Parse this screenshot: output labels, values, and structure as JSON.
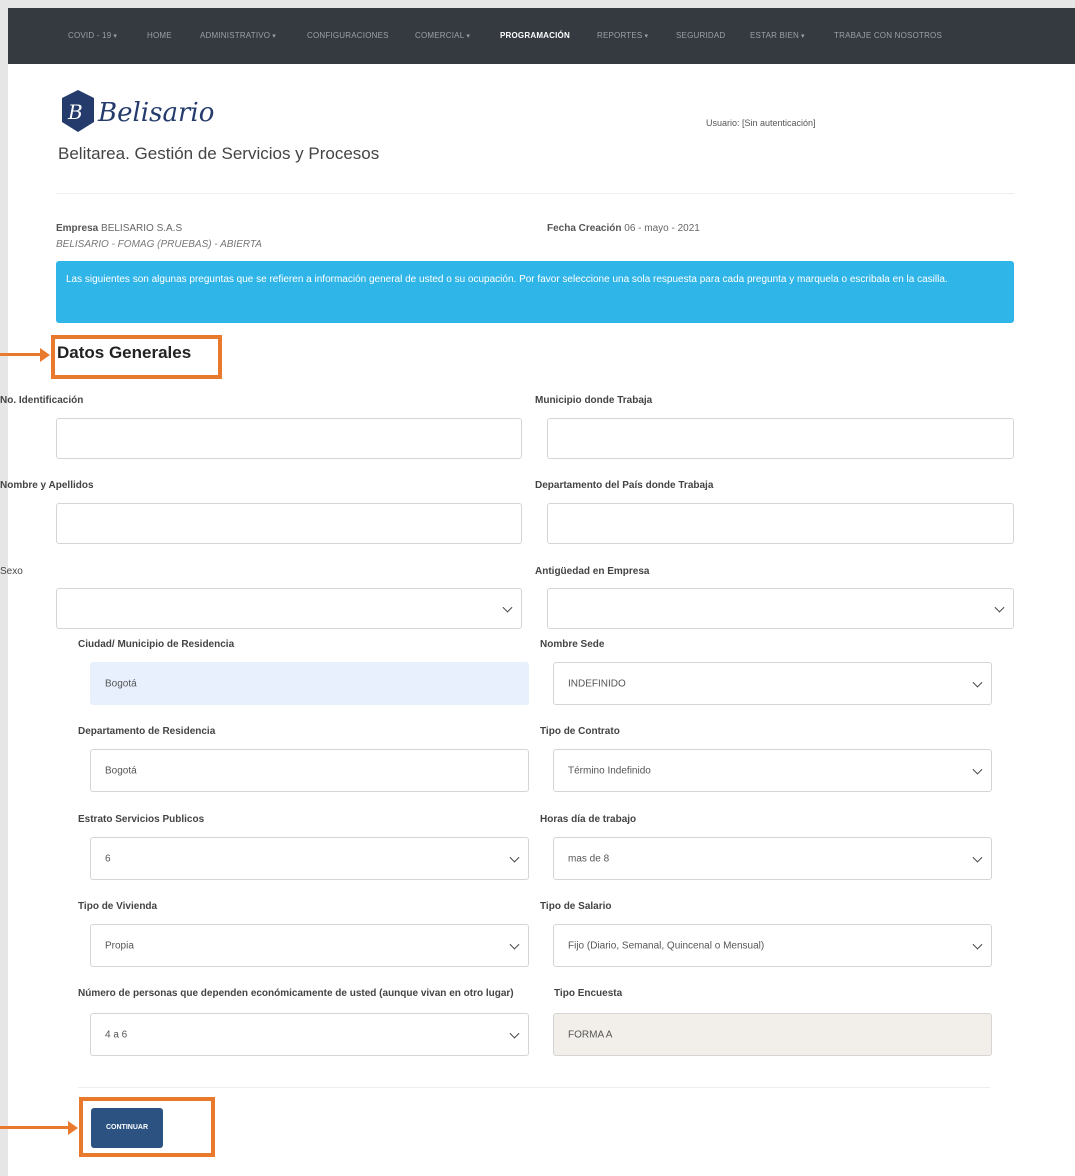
{
  "nav": {
    "items": [
      {
        "label": "COVID - 19",
        "dropdown": true
      },
      {
        "label": "HOME",
        "dropdown": false
      },
      {
        "label": "ADMINISTRATIVO",
        "dropdown": true
      },
      {
        "label": "CONFIGURACIONES",
        "dropdown": false
      },
      {
        "label": "COMERCIAL",
        "dropdown": true
      },
      {
        "label": "PROGRAMACIÓN",
        "dropdown": false,
        "active": true
      },
      {
        "label": "REPORTES",
        "dropdown": true
      },
      {
        "label": "SEGURIDAD",
        "dropdown": false
      },
      {
        "label": "ESTAR BIEN",
        "dropdown": true
      },
      {
        "label": "TRABAJE CON NOSOTROS",
        "dropdown": false
      }
    ]
  },
  "header": {
    "logo_text": "Belisario",
    "subtitle": "Belitarea. Gestión de Servicios y Procesos",
    "usuario": "Usuario: [Sin autenticación]"
  },
  "info": {
    "empresa_label": "Empresa",
    "empresa_value": "BELISARIO S.A.S",
    "empresa_sub": "BELISARIO - FOMAG (PRUEBAS) - ABIERTA",
    "fecha_label": "Fecha Creación",
    "fecha_value": "06 - mayo - 2021"
  },
  "alert": "Las siguientes son algunas preguntas que se refieren a información general de usted o su ocupación. Por favor seleccione una sola respuesta para cada pregunta y marquela o escribala en la casilla.",
  "section_title": "Datos Generales",
  "fields": {
    "no_identificacion": {
      "label": "No. Identificación",
      "value": ""
    },
    "municipio_trabaja": {
      "label": "Municipio donde Trabaja",
      "value": ""
    },
    "nombre": {
      "label": "Nombre y Apellidos",
      "value": ""
    },
    "departamento_trabaja": {
      "label": "Departamento del País donde Trabaja",
      "value": ""
    },
    "sexo": {
      "label": "Sexo",
      "value": ""
    },
    "antiguedad": {
      "label": "Antigüedad en Empresa",
      "value": ""
    },
    "ciudad_residencia": {
      "label": "Ciudad/ Municipio de Residencia",
      "value": "Bogotá"
    },
    "nombre_sede": {
      "label": "Nombre Sede",
      "value": "INDEFINIDO"
    },
    "departamento_residencia": {
      "label": "Departamento de Residencia",
      "value": "Bogotá"
    },
    "tipo_contrato": {
      "label": "Tipo de Contrato",
      "value": "Término Indefinido"
    },
    "estrato": {
      "label": "Estrato Servicios Publicos",
      "value": "6"
    },
    "horas_dia": {
      "label": "Horas día de trabajo",
      "value": "mas de 8"
    },
    "tipo_vivienda": {
      "label": "Tipo de Vivienda",
      "value": "Propia"
    },
    "tipo_salario": {
      "label": "Tipo de Salario",
      "value": "Fijo (Diario, Semanal, Quincenal o Mensual)"
    },
    "personas_dependen": {
      "label": "Número de personas que dependen económicamente de usted (aunque vivan en otro lugar)",
      "value": "4 a 6"
    },
    "tipo_encuesta": {
      "label": "Tipo Encuesta",
      "value": "FORMA A"
    }
  },
  "buttons": {
    "continuar": "CONTINUAR"
  },
  "colors": {
    "navbar": "#343a40",
    "alert": "#2fb5e8",
    "button": "#2c5282",
    "highlight": "#e97a2d"
  }
}
